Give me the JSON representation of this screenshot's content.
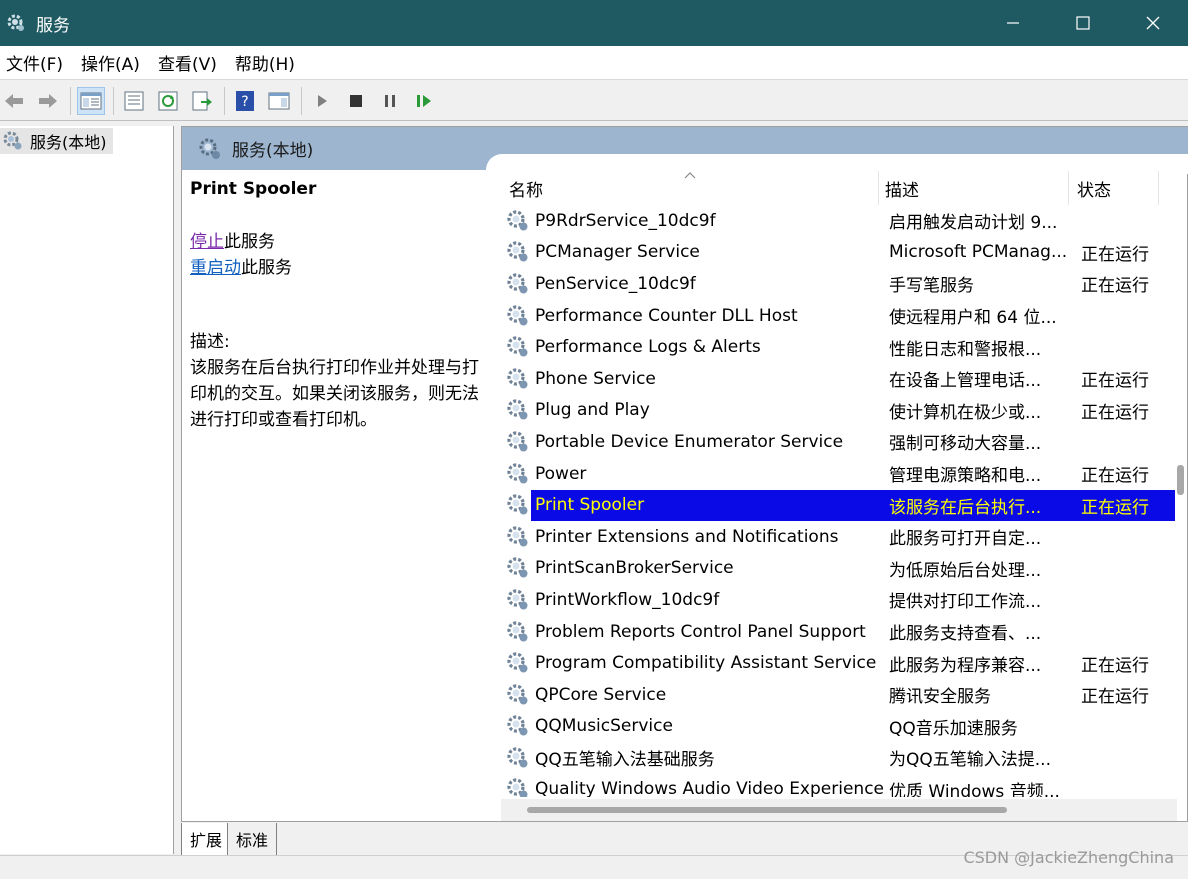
{
  "window": {
    "title": "服务",
    "minimize_glyph": "—",
    "maximize_glyph": "☐",
    "close_glyph": "✕"
  },
  "menu": [
    "文件(F)",
    "操作(A)",
    "查看(V)",
    "帮助(H)"
  ],
  "toolbar": {
    "icons": [
      "back-arrow-icon",
      "forward-arrow-icon",
      "console-tree-icon",
      "properties-icon",
      "refresh-icon",
      "export-list-icon",
      "help-icon",
      "show-hide-pane-icon",
      "start-service-icon",
      "stop-service-icon",
      "pause-service-icon",
      "resume-service-icon"
    ]
  },
  "tree": {
    "item_label": "服务(本地)"
  },
  "main": {
    "header": "服务(本地)",
    "detail": {
      "service_name": "Print Spooler",
      "stop_link": "停止",
      "stop_suffix": "此服务",
      "restart_link": "重启动",
      "restart_suffix": "此服务",
      "desc_label": "描述:",
      "desc_text": "该服务在后台执行打印作业并处理与打印机的交互。如果关闭该服务，则无法进行打印或查看打印机。"
    },
    "columns": {
      "name": "名称",
      "description": "描述",
      "status": "状态"
    },
    "rows": [
      {
        "name": "P9RdrService_10dc9f",
        "desc": "启用触发启动计划 9...",
        "status": ""
      },
      {
        "name": "PCManager Service",
        "desc": "Microsoft PCManag...",
        "status": "正在运行"
      },
      {
        "name": "PenService_10dc9f",
        "desc": "手写笔服务",
        "status": "正在运行"
      },
      {
        "name": "Performance Counter DLL Host",
        "desc": "使远程用户和 64 位...",
        "status": ""
      },
      {
        "name": "Performance Logs & Alerts",
        "desc": "性能日志和警报根...",
        "status": ""
      },
      {
        "name": "Phone Service",
        "desc": "在设备上管理电话...",
        "status": "正在运行"
      },
      {
        "name": "Plug and Play",
        "desc": "使计算机在极少或...",
        "status": "正在运行"
      },
      {
        "name": "Portable Device Enumerator Service",
        "desc": "强制可移动大容量...",
        "status": ""
      },
      {
        "name": "Power",
        "desc": "管理电源策略和电...",
        "status": "正在运行"
      },
      {
        "name": "Print Spooler",
        "desc": "该服务在后台执行...",
        "status": "正在运行",
        "selected": true
      },
      {
        "name": "Printer Extensions and Notifications",
        "desc": "此服务可打开自定...",
        "status": ""
      },
      {
        "name": "PrintScanBrokerService",
        "desc": "为低原始后台处理...",
        "status": ""
      },
      {
        "name": "PrintWorkflow_10dc9f",
        "desc": "提供对打印工作流...",
        "status": ""
      },
      {
        "name": "Problem Reports Control Panel Support",
        "desc": "此服务支持查看、...",
        "status": ""
      },
      {
        "name": "Program Compatibility Assistant Service",
        "desc": "此服务为程序兼容...",
        "status": "正在运行"
      },
      {
        "name": "QPCore Service",
        "desc": "腾讯安全服务",
        "status": "正在运行"
      },
      {
        "name": "QQMusicService",
        "desc": "QQ音乐加速服务",
        "status": ""
      },
      {
        "name": "QQ五笔输入法基础服务",
        "desc": "为QQ五笔输入法提...",
        "status": ""
      },
      {
        "name": "Quality Windows Audio Video Experience",
        "desc": "优质 Windows 音频...",
        "status": ""
      }
    ]
  },
  "tabs": [
    "扩展",
    "标准"
  ],
  "watermark": "CSDN @JackieZhengChina",
  "colors": {
    "titlebar": "#1f5a62",
    "selected_row_bg": "#0a0ae6",
    "selected_row_text": "#ffff00",
    "panel_header": "#9db5cf"
  }
}
